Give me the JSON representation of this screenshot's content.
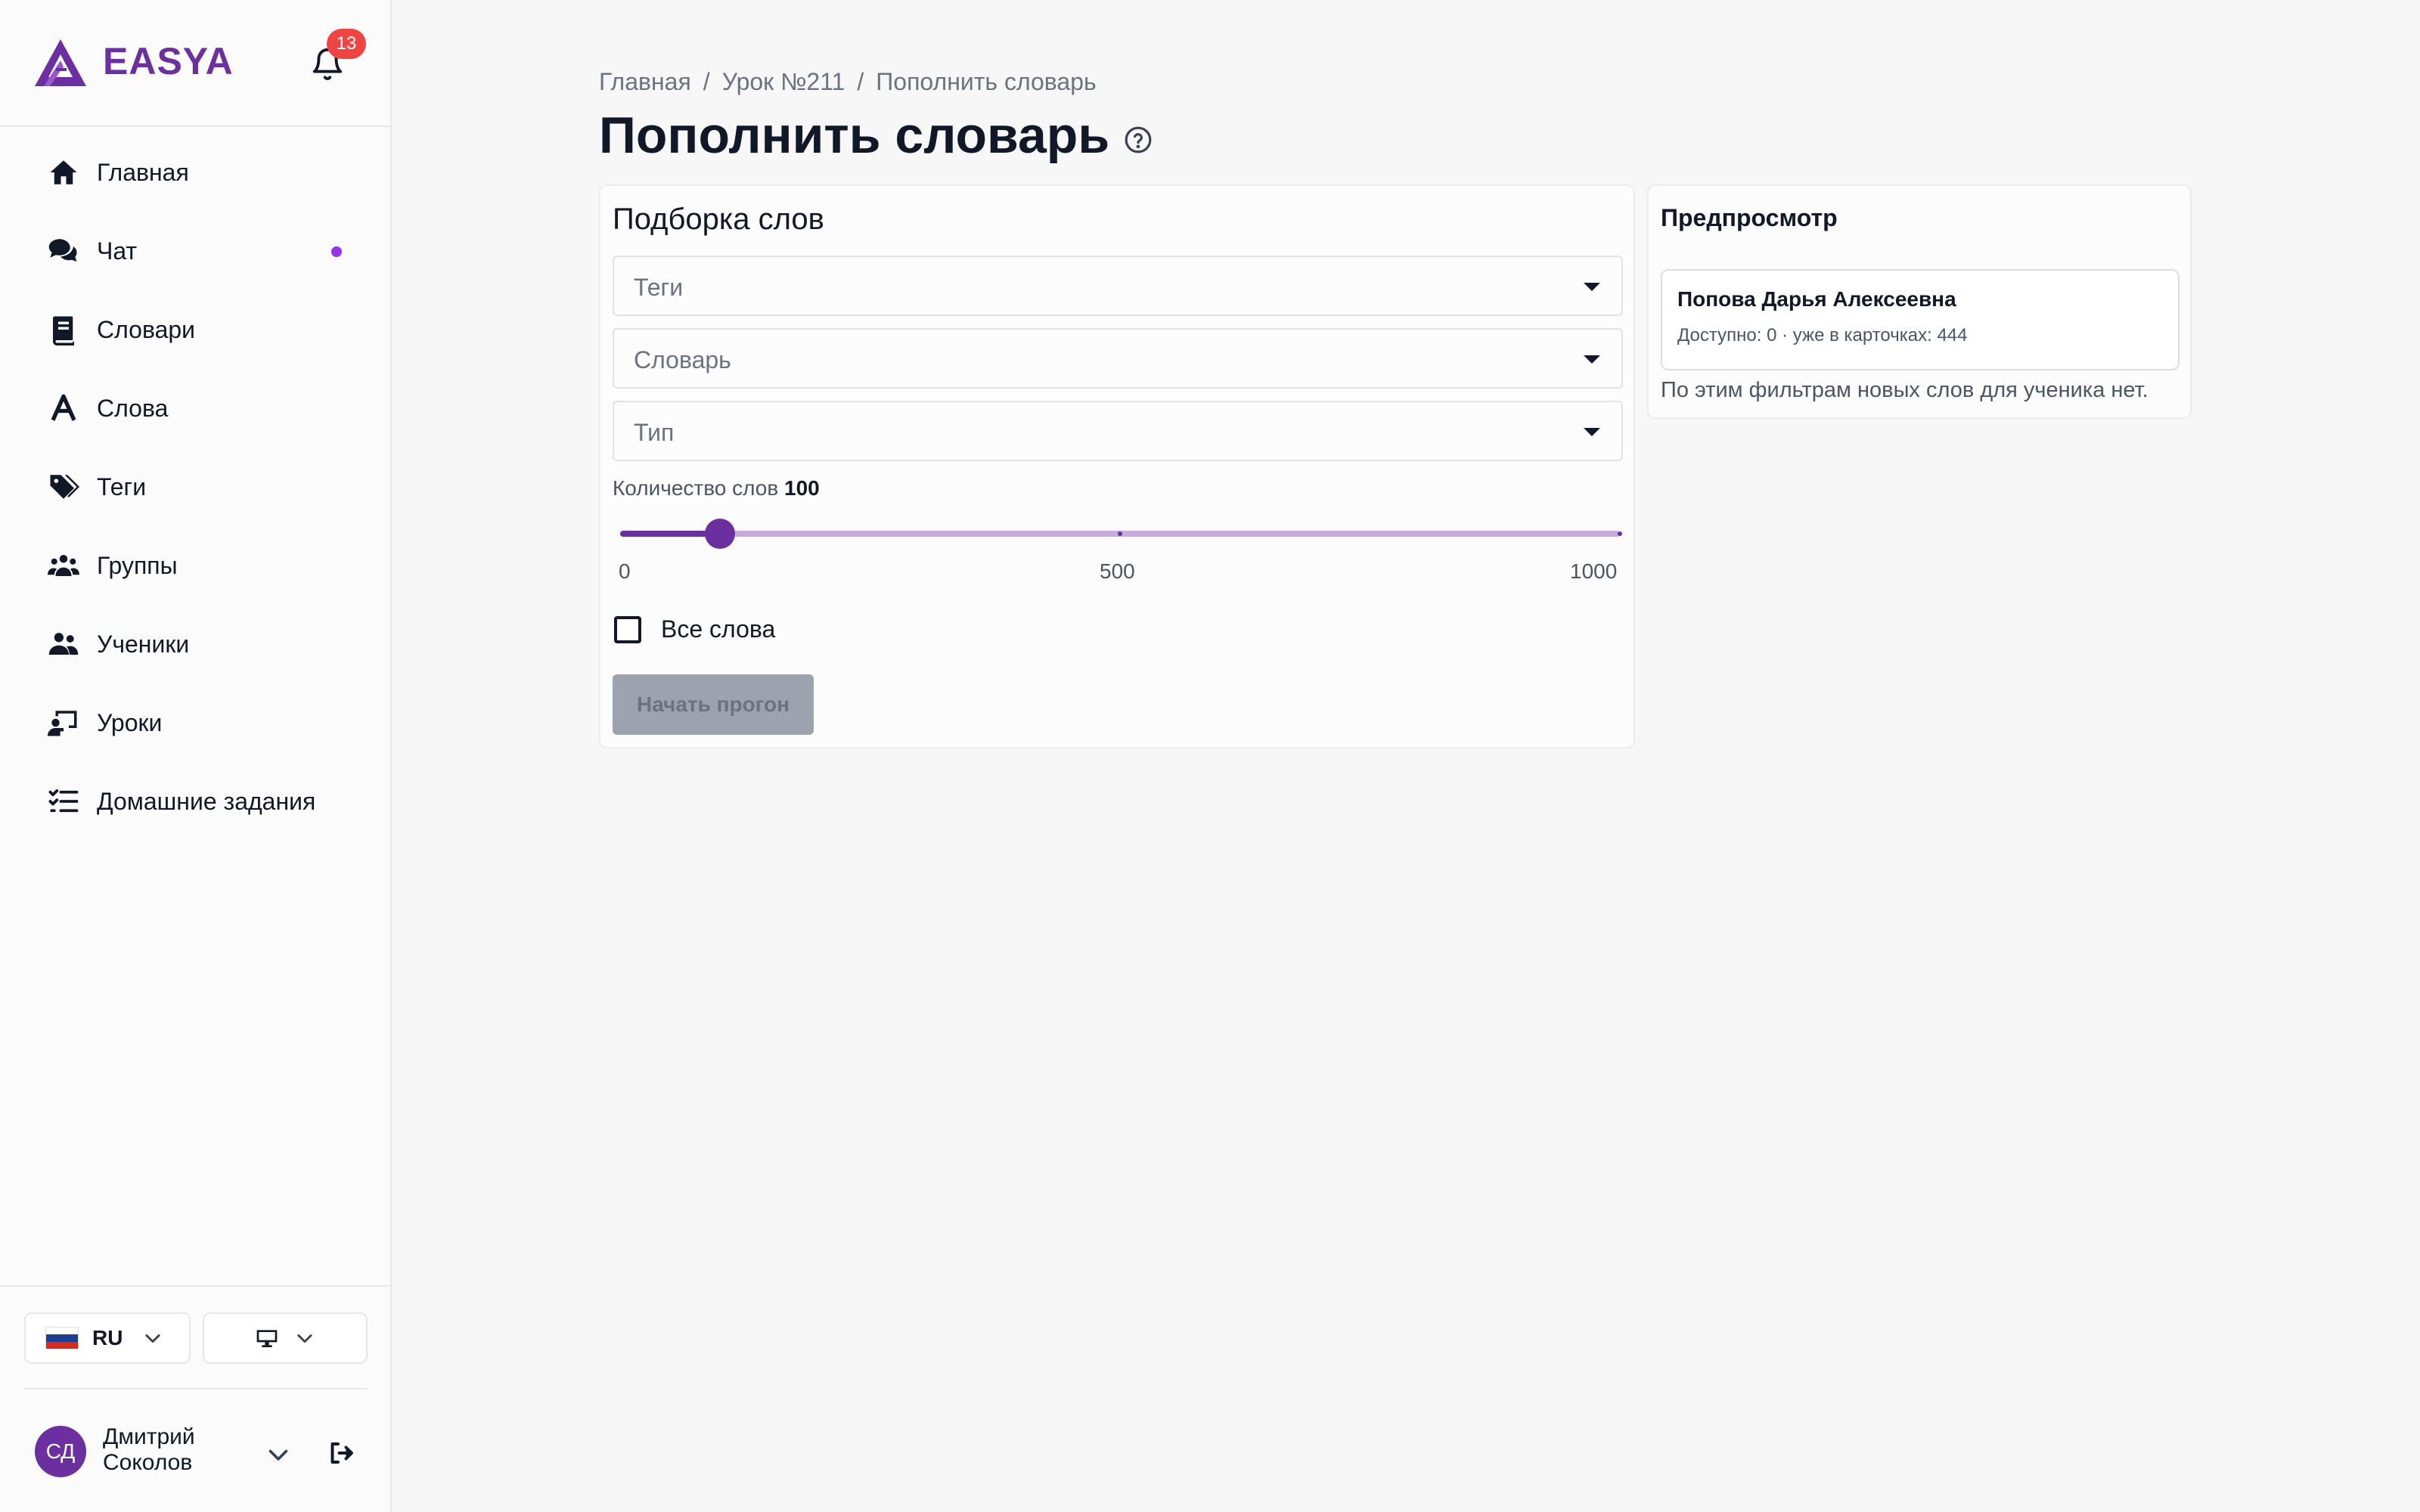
{
  "brand": {
    "name": "EASYA",
    "notifications": "13"
  },
  "nav": [
    {
      "label": "Главная",
      "icon": "home-icon"
    },
    {
      "label": "Чат",
      "icon": "chat-icon",
      "dot": true
    },
    {
      "label": "Словари",
      "icon": "book-icon"
    },
    {
      "label": "Слова",
      "icon": "letter-a-icon"
    },
    {
      "label": "Теги",
      "icon": "tags-icon"
    },
    {
      "label": "Группы",
      "icon": "group-icon"
    },
    {
      "label": "Ученики",
      "icon": "students-icon"
    },
    {
      "label": "Уроки",
      "icon": "lessons-icon"
    },
    {
      "label": "Домашние задания",
      "icon": "checklist-icon"
    }
  ],
  "footer": {
    "language": "RU",
    "theme_icon": "monitor-icon",
    "user": {
      "initials": "СД",
      "name": "Дмитрий Соколов"
    }
  },
  "breadcrumb": [
    "Главная",
    "Урок №211",
    "Пополнить словарь"
  ],
  "page_title": "Пополнить словарь",
  "picker": {
    "title": "Подборка слов",
    "selects": [
      "Теги",
      "Словарь",
      "Тип"
    ],
    "count_label": "Количество слов",
    "count_value": "100",
    "slider": {
      "min": 0,
      "max": 1000,
      "value": 100,
      "ticks": [
        "0",
        "500",
        "1000"
      ]
    },
    "all_words_label": "Все слова",
    "start_button": "Начать прогон"
  },
  "preview": {
    "title": "Предпросмотр",
    "student_name": "Попова Дарья Алексеевна",
    "student_stats": "Доступно: 0 · уже в карточках: 444",
    "note": "По этим фильтрам новых слов для ученика нет."
  },
  "colors": {
    "brand": "#6b2fa0",
    "badge": "#ef4444",
    "dot": "#9333ea"
  }
}
